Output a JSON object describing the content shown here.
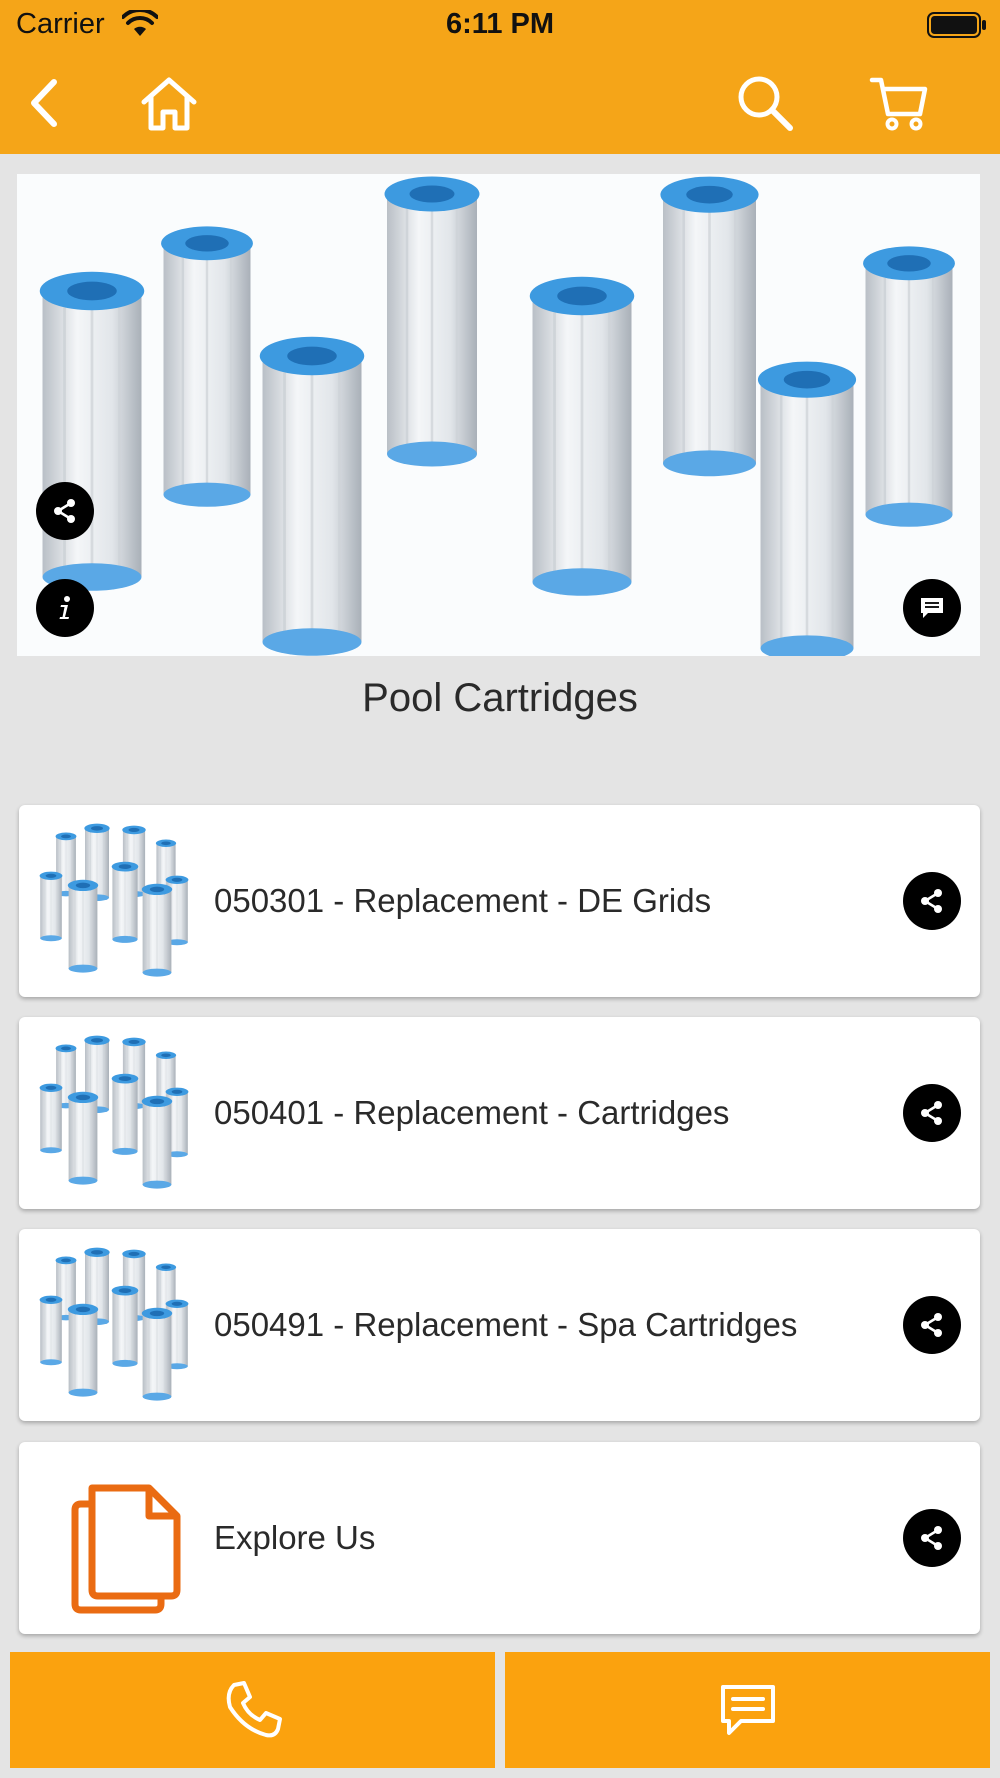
{
  "status_bar": {
    "carrier": "Carrier",
    "time": "6:11 PM"
  },
  "nav": {
    "icons": [
      "back-icon",
      "home-icon",
      "search-icon",
      "cart-icon"
    ]
  },
  "hero": {
    "image": "pool-cartridges-banner",
    "icons": [
      "share-icon",
      "info-icon",
      "chat-icon"
    ]
  },
  "page_title": "Pool Cartridges",
  "items": [
    {
      "label": "050301 - Replacement - DE Grids",
      "thumb": "cartridges-thumb"
    },
    {
      "label": "050401 - Replacement - Cartridges",
      "thumb": "cartridges-thumb"
    },
    {
      "label": "050491 - Replacement - Spa Cartridges",
      "thumb": "cartridges-thumb"
    },
    {
      "label": "Explore Us",
      "thumb": "documents-icon"
    }
  ],
  "bottom_bar": {
    "icons": [
      "phone-icon",
      "message-icon"
    ]
  },
  "colors": {
    "accent": "#f5a518",
    "bottom_buttons": "#fba20e",
    "background": "#e4e4e4",
    "cartridge_cap": "#3d9ae0",
    "explore_icon": "#ea6b12"
  }
}
